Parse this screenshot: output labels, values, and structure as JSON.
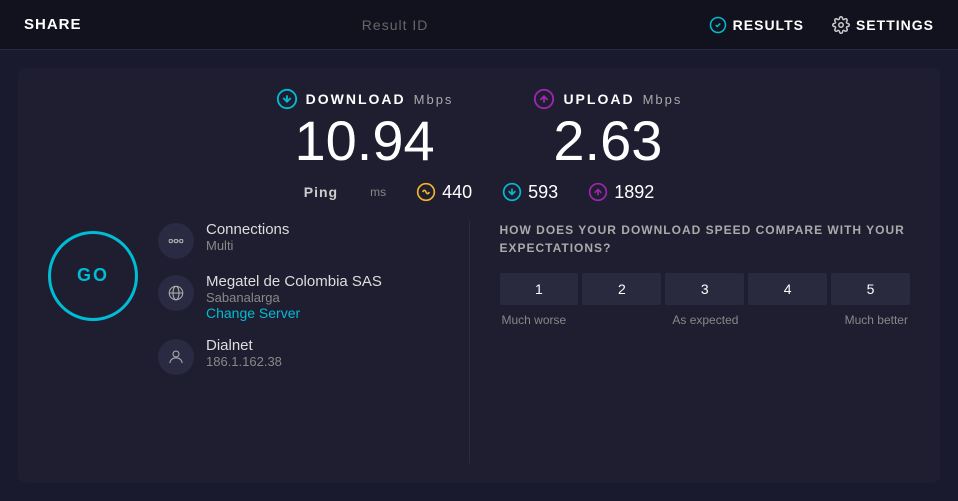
{
  "topbar": {
    "share_label": "SHARE",
    "result_label": "Result ID",
    "results_label": "RESULTS",
    "settings_label": "SETTINGS"
  },
  "speeds": {
    "download_label": "DOWNLOAD",
    "download_unit": "Mbps",
    "download_value": "10.94",
    "upload_label": "UPLOAD",
    "upload_unit": "Mbps",
    "upload_value": "2.63"
  },
  "ping": {
    "label": "Ping",
    "unit": "ms",
    "jitter_value": "440",
    "down_value": "593",
    "up_value": "1892"
  },
  "connections": {
    "icon_label": "connections-icon",
    "label": "Connections",
    "type": "Multi"
  },
  "server": {
    "icon_label": "globe-icon",
    "name": "Megatel de Colombia SAS",
    "location": "Sabanalarga",
    "change_label": "Change Server"
  },
  "user": {
    "icon_label": "person-icon",
    "name": "Dialnet",
    "ip": "186.1.162.38"
  },
  "go_button": {
    "label": "GO"
  },
  "compare": {
    "title": "HOW DOES YOUR DOWNLOAD SPEED COMPARE\nWITH YOUR EXPECTATIONS?",
    "ratings": [
      "1",
      "2",
      "3",
      "4",
      "5"
    ],
    "label_left": "Much worse",
    "label_mid": "As expected",
    "label_right": "Much better"
  }
}
